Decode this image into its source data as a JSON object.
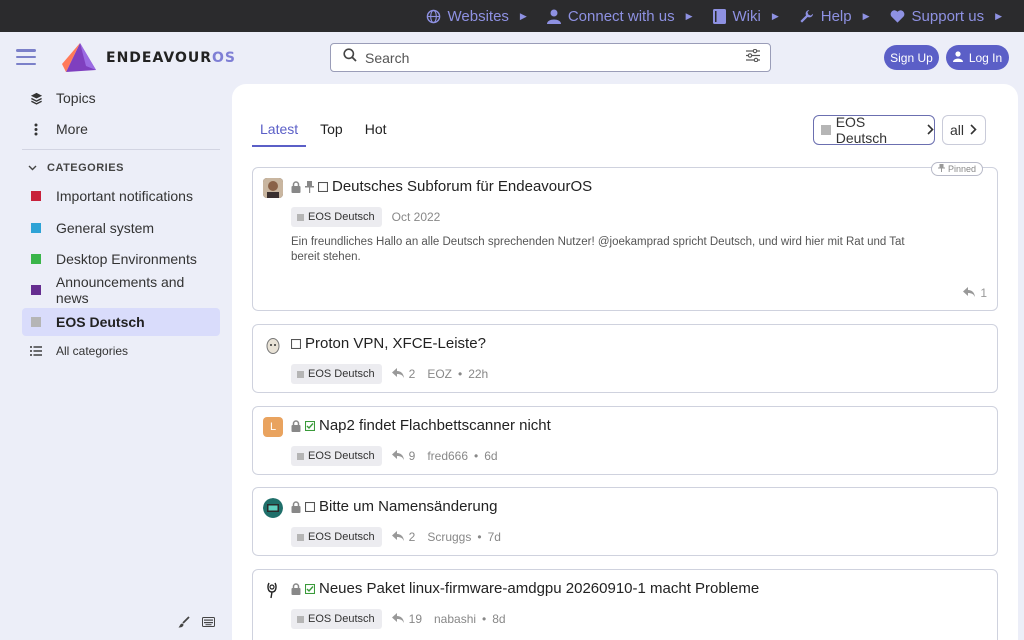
{
  "topnav": [
    {
      "label": "Websites",
      "icon": "globe-icon"
    },
    {
      "label": "Connect with us",
      "icon": "person-icon"
    },
    {
      "label": "Wiki",
      "icon": "book-icon"
    },
    {
      "label": "Help",
      "icon": "wrench-icon"
    },
    {
      "label": "Support us",
      "icon": "heart-icon"
    }
  ],
  "header": {
    "logo_text": "ENDEAVOUR",
    "logo_suffix": "OS",
    "search_placeholder": "Search",
    "signup_label": "Sign Up",
    "login_label": "Log In"
  },
  "sidebar": {
    "topics_label": "Topics",
    "more_label": "More",
    "categories_heading": "CATEGORIES",
    "categories": [
      {
        "label": "Important notifications",
        "color": "#c8213b"
      },
      {
        "label": "General system",
        "color": "#2ea3d6"
      },
      {
        "label": "Desktop Environments",
        "color": "#3ab54a"
      },
      {
        "label": "Announcements and news",
        "color": "#652d90"
      },
      {
        "label": "EOS Deutsch",
        "color": "#b5b5b5"
      }
    ],
    "all_categories_label": "All categories"
  },
  "main": {
    "tabs": [
      {
        "label": "Latest"
      },
      {
        "label": "Top"
      },
      {
        "label": "Hot"
      }
    ],
    "category_filter": "EOS Deutsch",
    "tag_filter": "all"
  },
  "topics": [
    {
      "title": "Deutsches Subforum für EndeavourOS",
      "category": "EOS Deutsch",
      "date": "Oct 2022",
      "pinned_label": "Pinned",
      "excerpt": "Ein freundliches Hallo an alle Deutsch sprechenden Nutzer! @joekamprad spricht Deutsch, und wird hier mit Rat und Tat bereit stehen.",
      "replies": "1"
    },
    {
      "title": "Proton VPN, XFCE-Leiste?",
      "category": "EOS Deutsch",
      "replies": "2",
      "poster": "EOZ",
      "age": "22h"
    },
    {
      "title": "Nap2 findet Flachbettscanner nicht",
      "category": "EOS Deutsch",
      "replies": "9",
      "poster": "fred666",
      "age": "6d",
      "avatar_letter": "L"
    },
    {
      "title": "Bitte um Namensänderung",
      "category": "EOS Deutsch",
      "replies": "2",
      "poster": "Scruggs",
      "age": "7d"
    },
    {
      "title": "Neues Paket linux-firmware-amdgpu 20260910-1 macht Probleme",
      "category": "EOS Deutsch",
      "replies": "19",
      "poster": "nabashi",
      "age": "8d"
    }
  ],
  "colors": {
    "accent": "#5b5fc7",
    "topbar": "#2b2b2d",
    "topnav_text": "#8e91e2",
    "page_bg": "#eceef8"
  }
}
